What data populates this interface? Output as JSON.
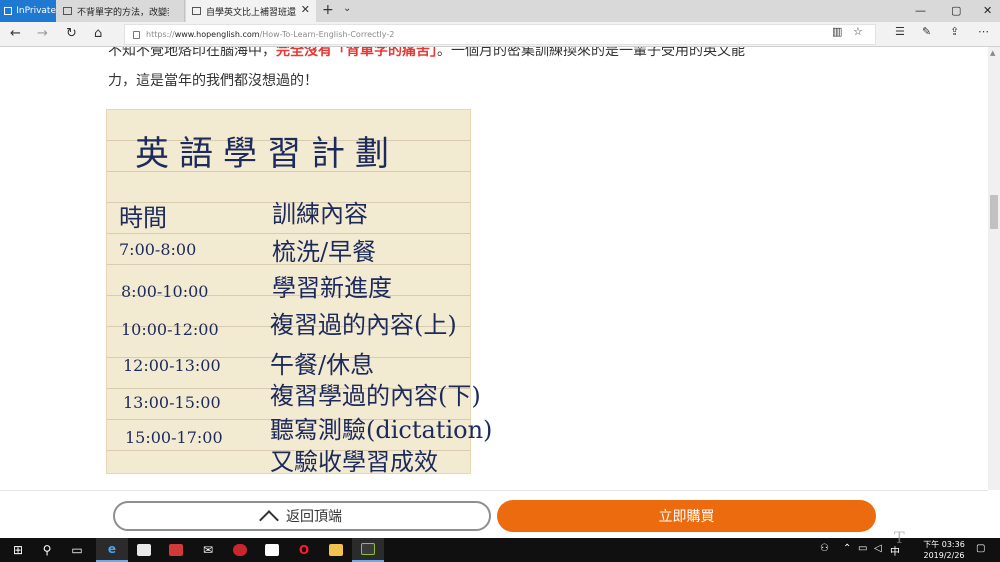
{
  "browser": {
    "inprivate_label": "InPrivate",
    "tabs": [
      {
        "label": "不背單字的方法，改變我的"
      },
      {
        "label": "自學英文比上補習班還"
      }
    ],
    "new_tab_glyph": "+",
    "tab_menu_glyph": "⌄",
    "close_glyph": "✕",
    "window_controls": {
      "minimize": "—",
      "maximize": "▢",
      "close": "✕"
    }
  },
  "addressbar": {
    "url_scheme": "https://",
    "url_host": "www.hopenglish.com",
    "url_path": "/How-To-Learn-English-Correctly-2",
    "nav_icons": [
      "back-icon",
      "forward-icon",
      "refresh-icon",
      "home-icon"
    ],
    "right_icons": [
      "reading-view-icon",
      "favorite-star-icon",
      "favorites-hub-icon",
      "pen-icon",
      "share-icon",
      "more-icon"
    ]
  },
  "article": {
    "line1_pre": "不知不覺地烙印在腦海中，",
    "line1_highlight": "完全沒有「背單字的痛苦」",
    "line1_post": "。一個月的密集訓練換來的是一輩子受用的英文能",
    "line2": "力，這是當年的我們都沒想過的！",
    "note": {
      "title": "英語學習計劃",
      "header_time": "時間",
      "header_content": "訓練內容",
      "rows": [
        {
          "time": "7:00-8:00",
          "activity": "梳洗/早餐"
        },
        {
          "time": "8:00-10:00",
          "activity": "學習新進度"
        },
        {
          "time": "10:00-12:00",
          "activity": "複習過的內容(上)"
        },
        {
          "time": "12:00-13:00",
          "activity": "午餐/休息"
        },
        {
          "time": "13:00-15:00",
          "activity": "複習學過的內容(下)"
        },
        {
          "time": "15:00-17:00",
          "activity": "聽寫測驗(dictation)"
        },
        {
          "time": "",
          "activity": "又驗收學習成效"
        }
      ]
    }
  },
  "bottom_bar": {
    "back_to_top_label": "返回頂端",
    "buy_label": "立即購買"
  },
  "colors": {
    "accent_orange": "#ec6b0e",
    "highlight_red": "#e53935",
    "inprivate_blue": "#1f78d1"
  },
  "taskbar": {
    "apps": [
      "windows-start-icon",
      "search-icon",
      "task-view-icon",
      "edge-icon",
      "store-icon",
      "gift-icon",
      "mail-icon",
      "app-red-icon",
      "app-square-icon",
      "opera-icon",
      "file-explorer-icon",
      "nox-icon"
    ],
    "time": "下午 03:36",
    "date": "2019/2/26"
  },
  "watermark": "T"
}
